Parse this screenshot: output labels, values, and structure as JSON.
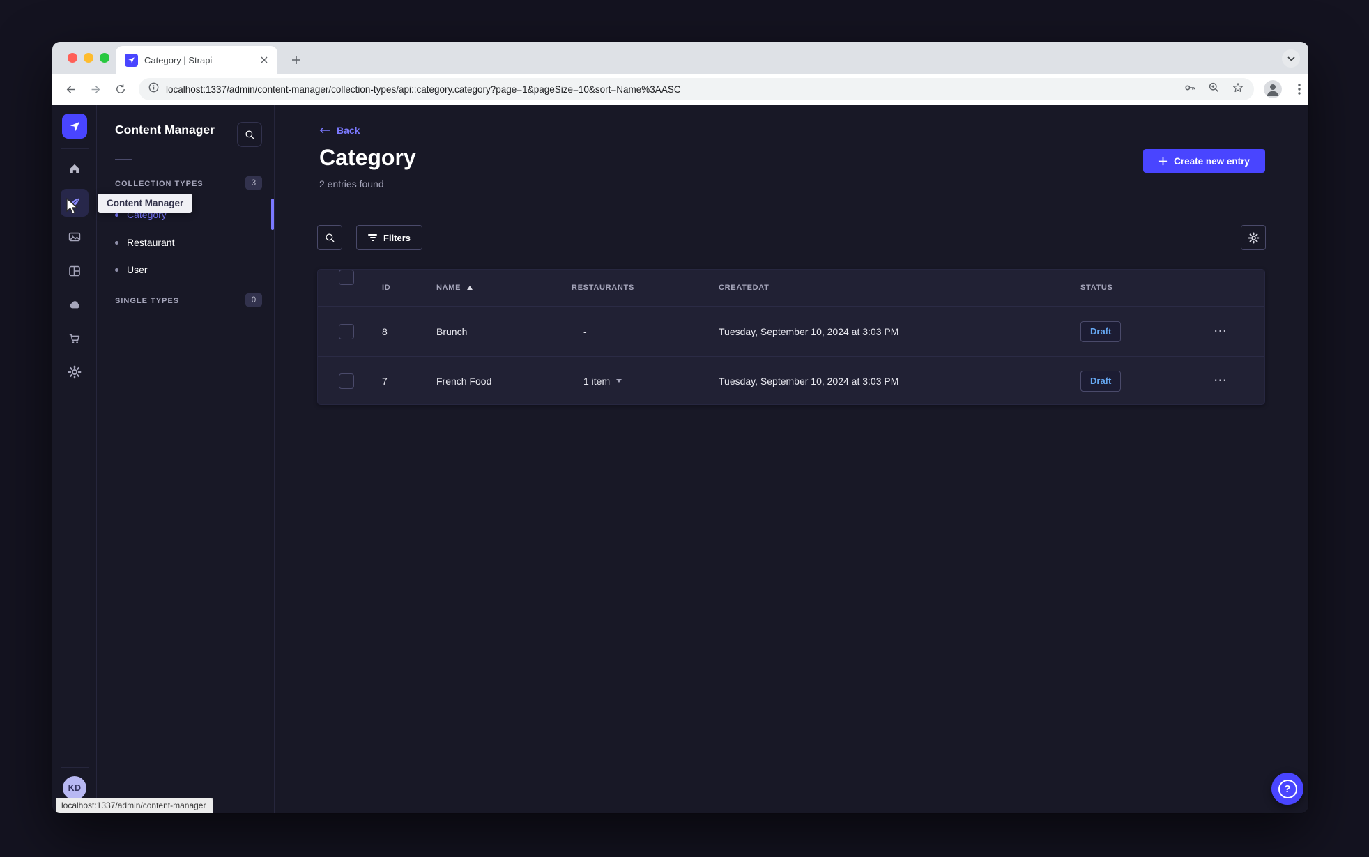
{
  "browser": {
    "tab_title": "Category | Strapi",
    "url": "localhost:1337/admin/content-manager/collection-types/api::category.category?page=1&pageSize=10&sort=Name%3AASC",
    "status_bar_text": "localhost:1337/admin/content-manager"
  },
  "nav_tooltip": "Content Manager",
  "subnav": {
    "title": "Content Manager",
    "collection_types_label": "COLLECTION TYPES",
    "collection_types_count": "3",
    "single_types_label": "SINGLE TYPES",
    "single_types_count": "0",
    "items": [
      {
        "label": "Category",
        "active": true
      },
      {
        "label": "Restaurant",
        "active": false
      },
      {
        "label": "User",
        "active": false
      }
    ]
  },
  "main": {
    "back_label": "Back",
    "title": "Category",
    "entries_count": "2 entries found",
    "create_button_label": "Create new entry",
    "filters_button_label": "Filters",
    "table": {
      "headers": {
        "id": "ID",
        "name": "NAME",
        "restaurants": "RESTAURANTS",
        "createdat": "CREATEDAT",
        "status": "STATUS"
      },
      "sort_column": "NAME",
      "sort_direction": "ASC",
      "rows": [
        {
          "id": "8",
          "name": "Brunch",
          "restaurants": "-",
          "createdat": "Tuesday, September 10, 2024 at 3:03 PM",
          "status": "Draft"
        },
        {
          "id": "7",
          "name": "French Food",
          "restaurants": "1 item",
          "createdat": "Tuesday, September 10, 2024 at 3:03 PM",
          "status": "Draft"
        }
      ]
    }
  },
  "user": {
    "initials": "KD"
  },
  "icons": {
    "row_actions": "⋯",
    "help": "?"
  },
  "colors": {
    "primary": "#4945ff",
    "primary_light": "#7b79ff",
    "app_background": "#181826",
    "surface": "#212134",
    "border": "#32324d",
    "draft_text": "#66a7f1",
    "avatar_bg": "#b8b8f2"
  }
}
